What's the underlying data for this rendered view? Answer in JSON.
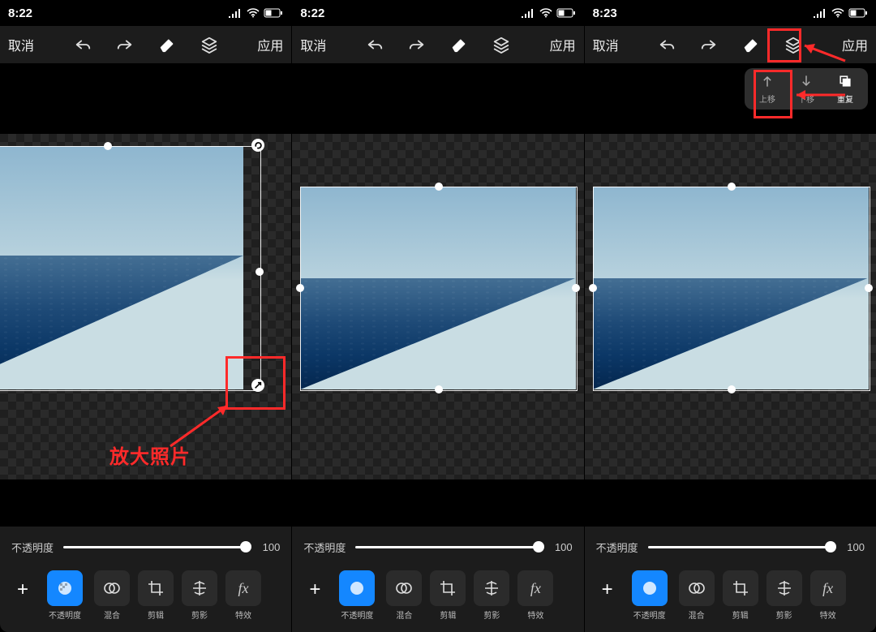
{
  "status": {
    "time1": "8:22",
    "time2": "8:22",
    "time3": "8:23"
  },
  "toolbar": {
    "cancel": "取消",
    "apply": "应用"
  },
  "submenu": {
    "up": "上移",
    "down": "下移",
    "dup": "重复"
  },
  "slider": {
    "label": "不透明度",
    "value": "100"
  },
  "tools": {
    "opacity": "不透明度",
    "blend": "混合",
    "crop": "剪辑",
    "shadow": "剪影",
    "fx": "特效"
  },
  "annotations": {
    "enlarge": "放大照片"
  },
  "colors": {
    "accent": "#1487ff",
    "highlight": "#ff2a2a"
  }
}
